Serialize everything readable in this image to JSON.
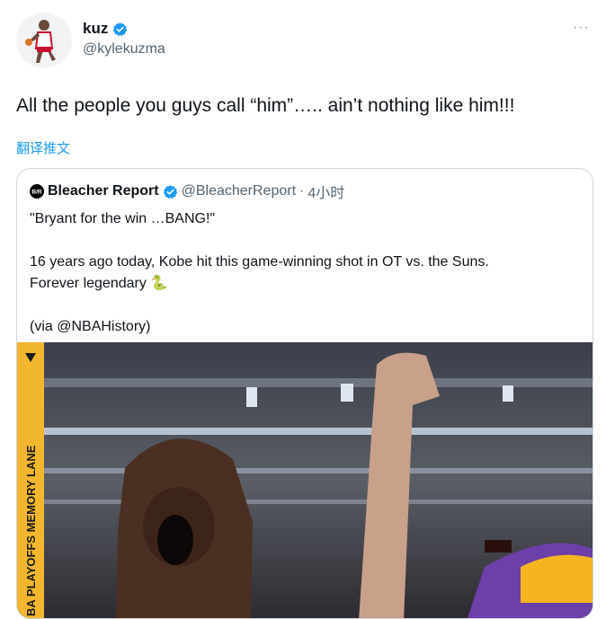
{
  "tweet": {
    "display_name": "kuz",
    "handle": "@kylekuzma",
    "more_icon": "more-icon",
    "text": "All the people you guys call “him”….. ain’t nothing like him!!!",
    "translate": "翻译推文"
  },
  "quote": {
    "display_name": "Bleacher Report",
    "handle": "@BleacherReport",
    "separator": "·",
    "time": "4小时",
    "text": "\"Bryant for the win …BANG!\"\n\n16 years ago today, Kobe hit this game-winning shot in OT vs. the Suns.\nForever legendary 🐍\n\n(via @NBAHistory)",
    "media_banner": "BA PLAYOFFS MEMORY LANE"
  },
  "colors": {
    "accent": "#1d9bf0",
    "lakers_purple": "#552583",
    "lakers_gold": "#fdb927"
  }
}
